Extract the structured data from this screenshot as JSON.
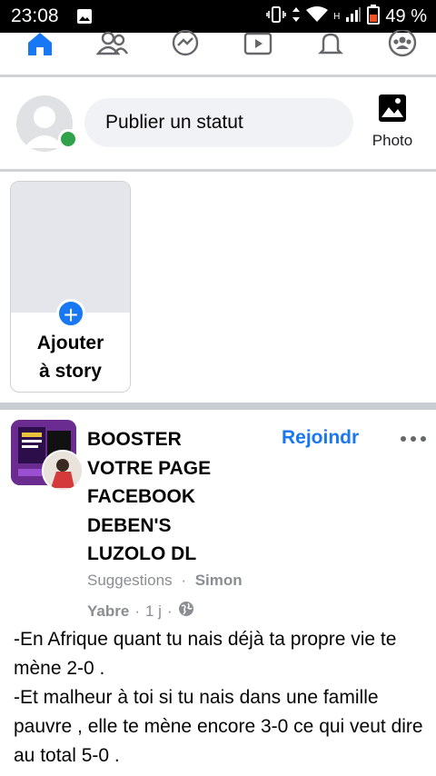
{
  "status_bar": {
    "time": "23:08",
    "network": "H",
    "battery": "49 %"
  },
  "nav": {
    "tabs": [
      {
        "name": "home",
        "icon": "home-icon",
        "active": true
      },
      {
        "name": "friends",
        "icon": "friends-icon"
      },
      {
        "name": "messenger",
        "icon": "messenger-icon"
      },
      {
        "name": "watch",
        "icon": "watch-icon"
      },
      {
        "name": "notifications",
        "icon": "bell-icon"
      },
      {
        "name": "groups",
        "icon": "groups-icon"
      }
    ],
    "accent": "#1877f2"
  },
  "composer": {
    "placeholder": "Publier un statut",
    "photo_label": "Photo",
    "online_color": "#31a24c"
  },
  "stories": {
    "create_line1": "Ajouter",
    "create_line2": "à story"
  },
  "post": {
    "title_lines": [
      "BOOSTER",
      "VOTRE PAGE",
      "FACEBOOK",
      "DEBEN'S",
      "LUZOLO DL"
    ],
    "join_label": "Rejoindr",
    "suggestions": "Suggestions",
    "author_first": "Simon",
    "author_last": "Yabre",
    "time": "1 j",
    "dot": "·",
    "body": [
      "-En Afrique quant tu nais déjà ta propre vie te mène 2-0 .",
      "-Et malheur à toi si tu nais dans une famille pauvre , elle te mène encore 3-0 ce qui veut dire au total 5-0 ."
    ]
  }
}
